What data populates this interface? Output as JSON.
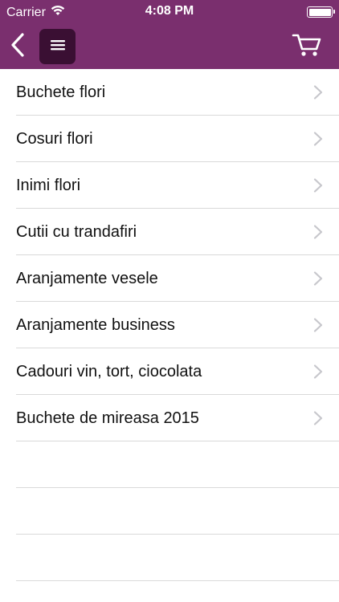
{
  "status_bar": {
    "carrier": "Carrier",
    "time": "4:08 PM",
    "wifi_icon": "wifi-icon",
    "battery_icon": "battery-icon"
  },
  "nav_bar": {
    "background": "#7a2f6e",
    "back_icon": "chevron-left-icon",
    "menu_icon": "hamburger-menu-icon",
    "cart_icon": "shopping-cart-icon"
  },
  "categories": [
    {
      "label": "Buchete flori"
    },
    {
      "label": "Cosuri flori"
    },
    {
      "label": "Inimi flori"
    },
    {
      "label": "Cutii cu trandafiri"
    },
    {
      "label": "Aranjamente vesele"
    },
    {
      "label": "Aranjamente business"
    },
    {
      "label": "Cadouri vin, tort, ciocolata"
    },
    {
      "label": "Buchete de mireasa 2015"
    }
  ]
}
